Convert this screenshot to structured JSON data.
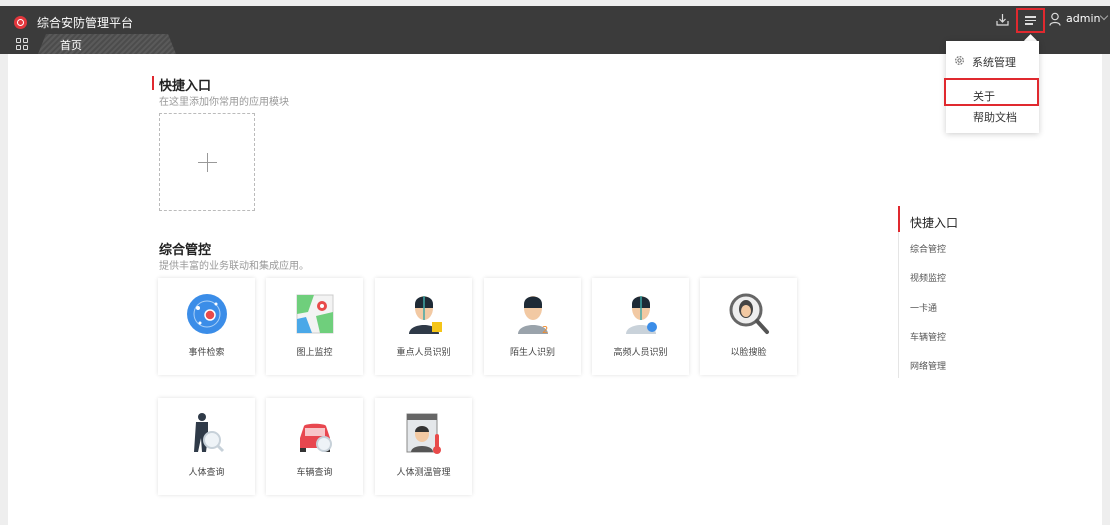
{
  "header": {
    "title": "综合安防管理平台",
    "tab_home": "首页",
    "user_name": "admin"
  },
  "quick": {
    "title": "快捷入口",
    "subtitle": "在这里添加你常用的应用模块"
  },
  "control": {
    "title": "综合管控",
    "subtitle": "提供丰富的业务联动和集成应用。",
    "cards": [
      {
        "label": "事件检索",
        "icon": "event-search-icon"
      },
      {
        "label": "图上监控",
        "icon": "map-monitor-icon"
      },
      {
        "label": "重点人员识别",
        "icon": "key-person-icon"
      },
      {
        "label": "陌生人识别",
        "icon": "stranger-icon"
      },
      {
        "label": "高频人员识别",
        "icon": "frequent-person-icon"
      },
      {
        "label": "以脸搜脸",
        "icon": "face-search-icon"
      },
      {
        "label": "人体查询",
        "icon": "body-search-icon"
      },
      {
        "label": "车辆查询",
        "icon": "vehicle-search-icon"
      },
      {
        "label": "人体测温管理",
        "icon": "temperature-icon"
      }
    ]
  },
  "anchor_nav": [
    {
      "label": "快捷入口"
    },
    {
      "label": "综合管控"
    },
    {
      "label": "视频监控"
    },
    {
      "label": "一卡通"
    },
    {
      "label": "车辆管控"
    },
    {
      "label": "网络管理"
    }
  ],
  "dropdown": {
    "items": [
      {
        "label": "系统管理"
      },
      {
        "label": "关于"
      },
      {
        "label": "帮助文档"
      }
    ]
  },
  "colors": {
    "accent": "#e0292f",
    "header_bg": "#3b3b3b",
    "page_bg": "#eeeeee"
  }
}
